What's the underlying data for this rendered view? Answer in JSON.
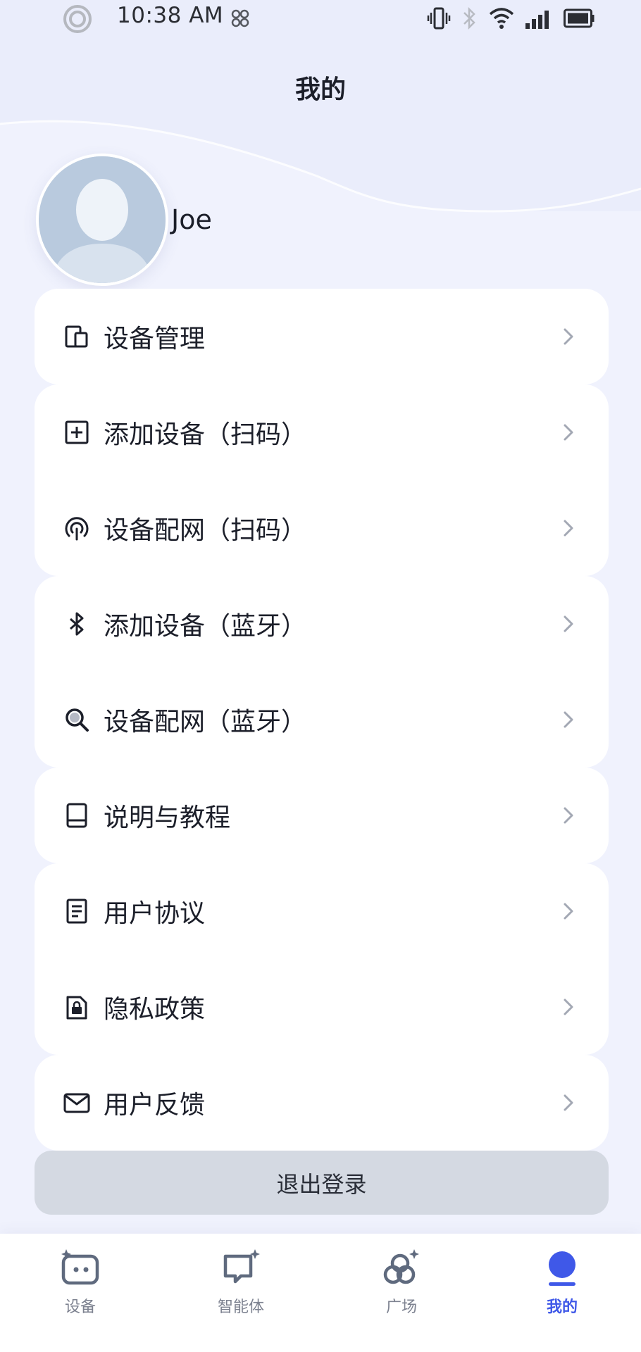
{
  "status_bar": {
    "time": "10:38 AM"
  },
  "header": {
    "title": "我的"
  },
  "profile": {
    "username": "Joe"
  },
  "menu": [
    {
      "id": "device-management",
      "label": "设备管理",
      "icon": "devices-icon"
    },
    {
      "id": "add-device-scan",
      "label": "添加设备（扫码）",
      "icon": "add-box-icon"
    },
    {
      "id": "network-scan",
      "label": "设备配网（扫码）",
      "icon": "wifi-tethering-icon"
    },
    {
      "id": "add-device-bluetooth",
      "label": "添加设备（蓝牙）",
      "icon": "bluetooth-icon"
    },
    {
      "id": "network-bluetooth",
      "label": "设备配网（蓝牙）",
      "icon": "search-icon"
    },
    {
      "id": "guide",
      "label": "说明与教程",
      "icon": "book-icon"
    },
    {
      "id": "user-agreement",
      "label": "用户协议",
      "icon": "document-icon"
    },
    {
      "id": "privacy",
      "label": "隐私政策",
      "icon": "lock-file-icon"
    },
    {
      "id": "feedback",
      "label": "用户反馈",
      "icon": "mail-icon"
    }
  ],
  "logout": {
    "label": "退出登录"
  },
  "bottom_nav": [
    {
      "label": "设备",
      "icon": "device-robot-icon",
      "active": false
    },
    {
      "label": "智能体",
      "icon": "agent-chat-icon",
      "active": false
    },
    {
      "label": "广场",
      "icon": "plaza-icon",
      "active": false
    },
    {
      "label": "我的",
      "icon": "profile-icon",
      "active": true
    }
  ],
  "colors": {
    "background": "#f0f2fd",
    "card": "#ffffff",
    "accent": "#3f58e8",
    "logout_button": "#d4d9e2",
    "nav_inactive": "#7d8290"
  }
}
